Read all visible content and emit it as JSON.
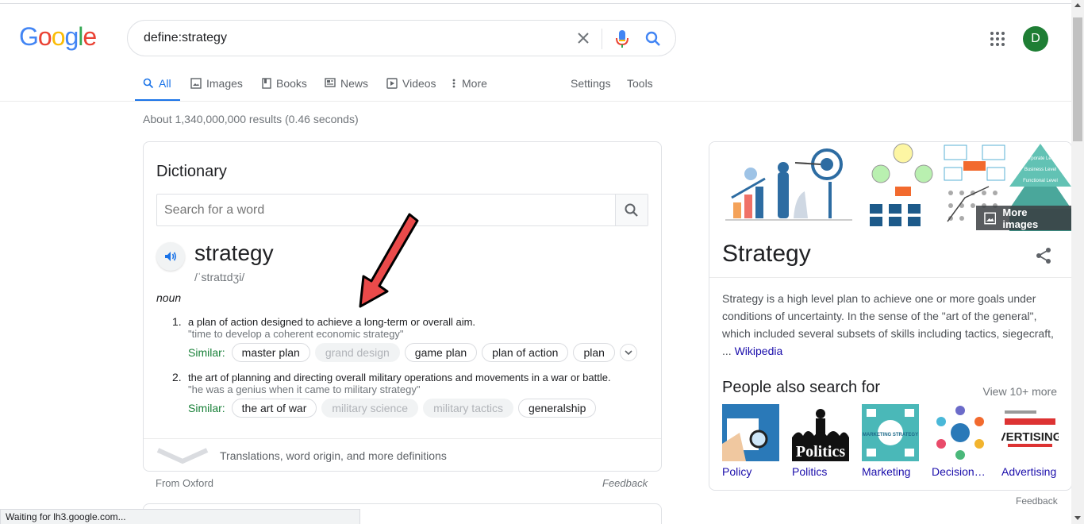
{
  "header": {
    "logo_letters": [
      "G",
      "o",
      "o",
      "g",
      "l",
      "e"
    ],
    "search_query": "define:strategy",
    "avatar_letter": "D"
  },
  "tabs": [
    {
      "label": "All",
      "icon": "search-icon",
      "active": true
    },
    {
      "label": "Images",
      "icon": "image-icon"
    },
    {
      "label": "Books",
      "icon": "book-icon"
    },
    {
      "label": "News",
      "icon": "news-icon"
    },
    {
      "label": "Videos",
      "icon": "video-icon"
    },
    {
      "label": "More",
      "icon": "more-vert-icon"
    },
    {
      "label": "Settings"
    },
    {
      "label": "Tools"
    }
  ],
  "result_stats": "About 1,340,000,000 results (0.46 seconds)",
  "dictionary": {
    "title": "Dictionary",
    "search_placeholder": "Search for a word",
    "word": "strategy",
    "phonetic": "/ˈstratɪdʒi/",
    "part_of_speech": "noun",
    "definitions": [
      {
        "num": "1.",
        "text": "a plan of action designed to achieve a long-term or overall aim.",
        "example": "\"time to develop a coherent economic strategy\"",
        "similar_label": "Similar:",
        "similar": [
          "master plan",
          "grand design",
          "game plan",
          "plan of action",
          "plan"
        ]
      },
      {
        "num": "2.",
        "text": "the art of planning and directing overall military operations and movements in a war or battle.",
        "example": "\"he was a genius when it came to military strategy\"",
        "similar_label": "Similar:",
        "similar": [
          "the art of war",
          "military science",
          "military tactics",
          "generalship"
        ]
      }
    ],
    "footer_link": "Translations, word origin, and more definitions",
    "source": "From Oxford",
    "feedback": "Feedback"
  },
  "knowledge_panel": {
    "more_images": "More images",
    "title": "Strategy",
    "description": "Strategy is a high level plan to achieve one or more goals under conditions of uncertainty. In the sense of the \"art of the general\", which included several subsets of skills including tactics, siegecraft, ...",
    "description_link": "Wikipedia",
    "people_also_search": "People also search for",
    "view_more": "View 10+ more",
    "related": [
      {
        "label": "Policy"
      },
      {
        "label": "Politics"
      },
      {
        "label": "Marketing"
      },
      {
        "label": "Decision…"
      },
      {
        "label": "Advertising"
      }
    ],
    "image_text": {
      "img3_top": "Corporate Level",
      "img3_mid": "Business Level",
      "img3_bot": "Functional Level",
      "thumb_politics": "Politics",
      "thumb_marketing": "MARKETING STRATEGY",
      "thumb_advertising": "VERTISING"
    },
    "feedback": "Feedback"
  },
  "status_bar": "Waiting for lh3.google.com...",
  "colors": {
    "link": "#1a0dab",
    "accent": "#1a73e8",
    "similar_label": "#188038",
    "avatar": "#1e7e34",
    "annotation_arrow": "#ea4a4a"
  }
}
